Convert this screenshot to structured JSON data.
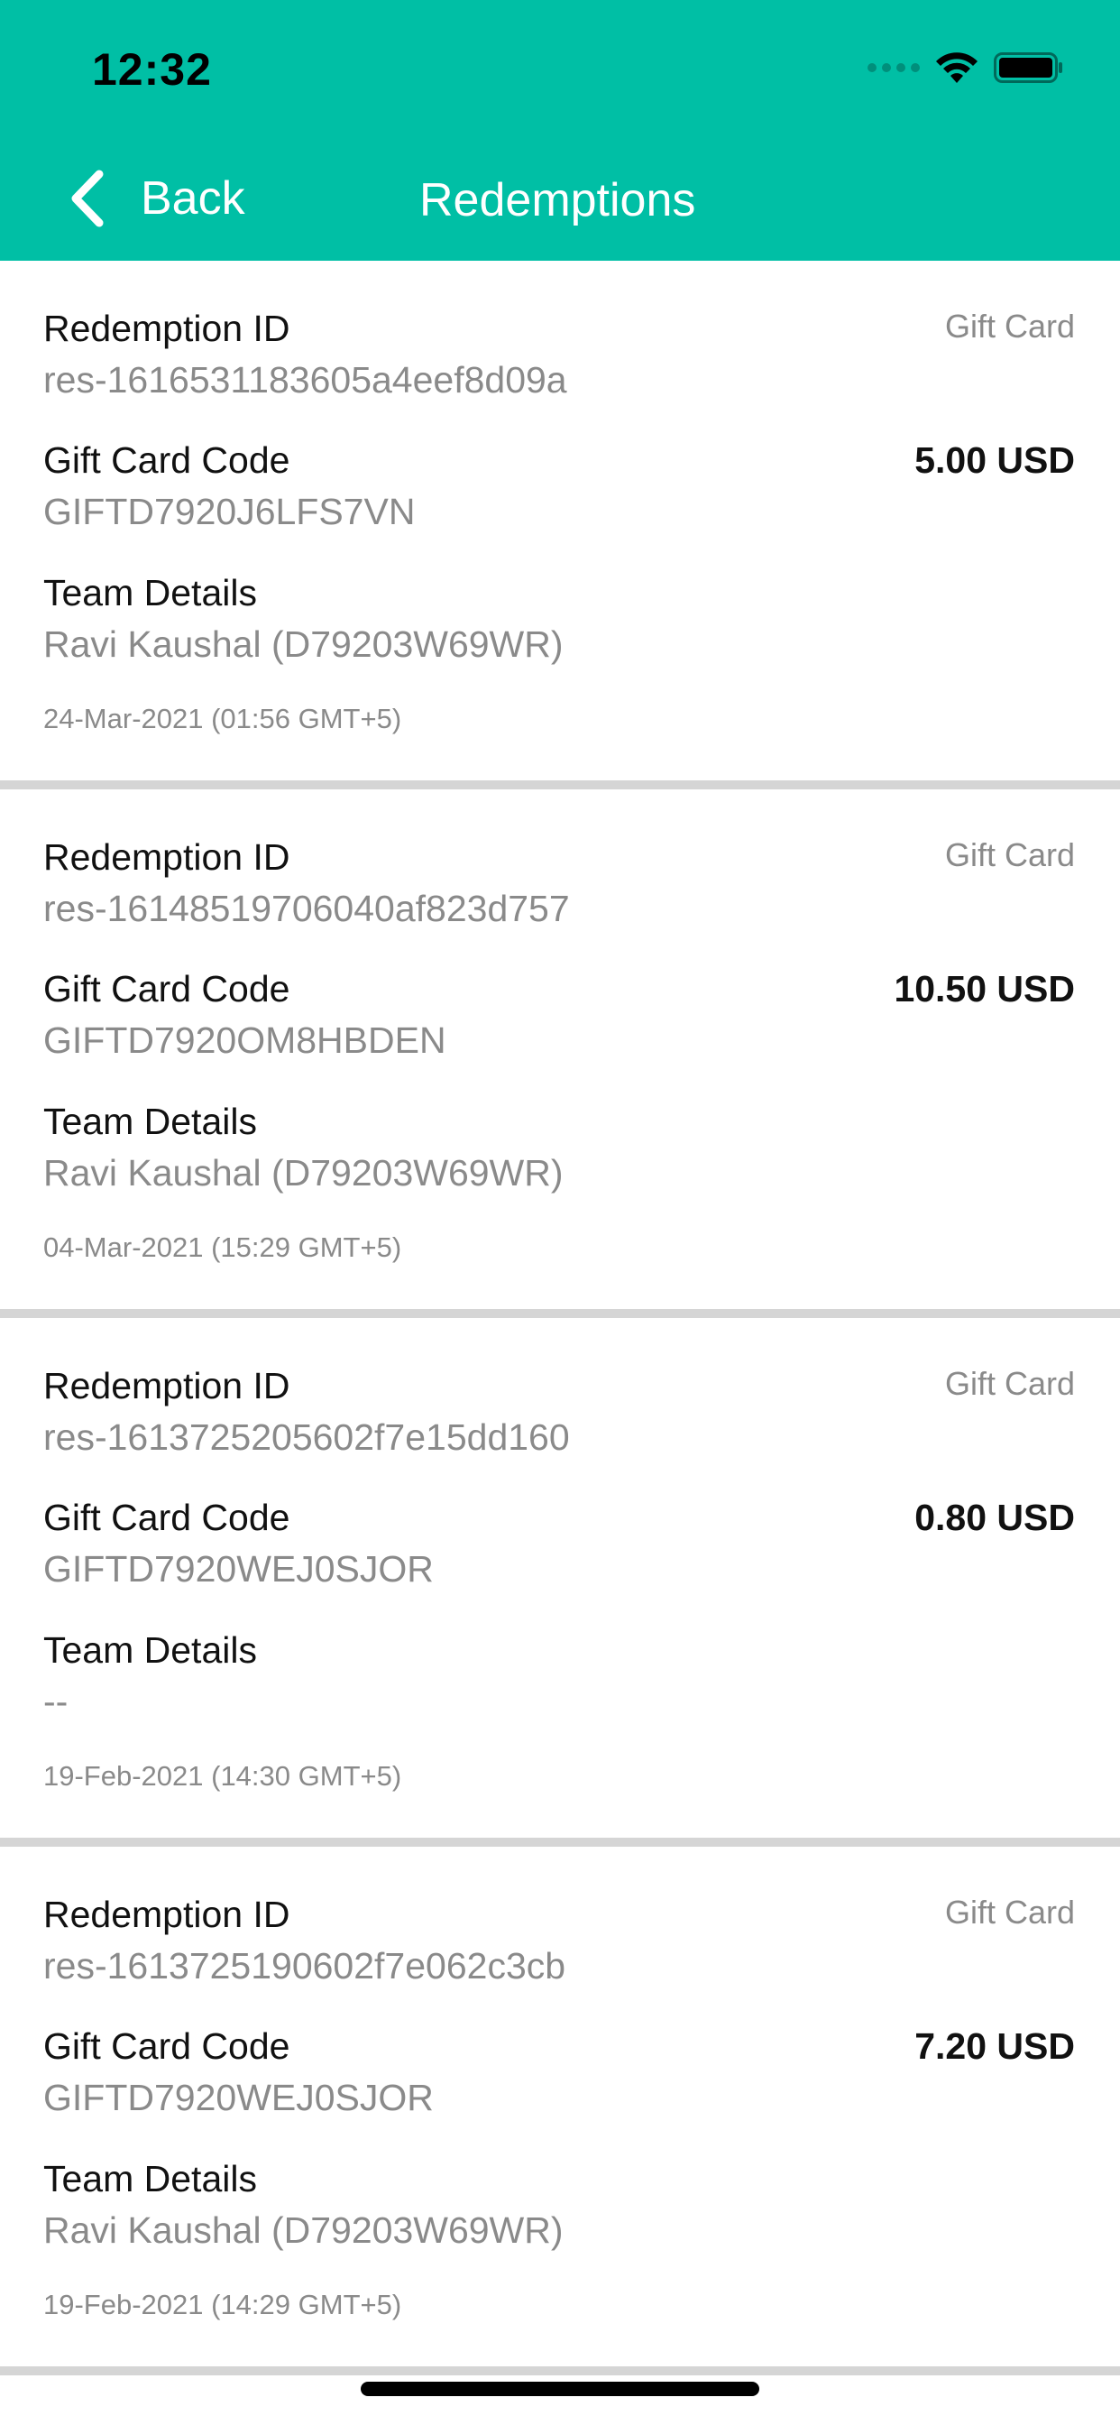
{
  "status_bar": {
    "time": "12:32"
  },
  "nav": {
    "back_label": "Back",
    "title": "Redemptions"
  },
  "labels": {
    "redemption_id": "Redemption ID",
    "gift_card_code": "Gift Card Code",
    "team_details": "Team Details"
  },
  "icons": {
    "back": "chevron-left-icon",
    "signal": "cellular-signal-icon",
    "wifi": "wifi-icon",
    "battery": "battery-icon"
  },
  "colors": {
    "header": "#00BFA5",
    "divider": "#D5D5D5",
    "secondary_text": "#8A8A8A"
  },
  "redemptions": [
    {
      "type": "Gift Card",
      "redemption_id": "res-1616531183605a4eef8d09a",
      "gift_card_code": "GIFTD7920J6LFS7VN",
      "amount": "5.00 USD",
      "team_details": "Ravi Kaushal (D79203W69WR)",
      "date": "24-Mar-2021 (01:56 GMT+5)"
    },
    {
      "type": "Gift Card",
      "redemption_id": "res-16148519706040af823d757",
      "gift_card_code": "GIFTD7920OM8HBDEN",
      "amount": "10.50 USD",
      "team_details": "Ravi Kaushal (D79203W69WR)",
      "date": "04-Mar-2021 (15:29 GMT+5)"
    },
    {
      "type": "Gift Card",
      "redemption_id": "res-1613725205602f7e15dd160",
      "gift_card_code": "GIFTD7920WEJ0SJOR",
      "amount": "0.80 USD",
      "team_details": "--",
      "date": "19-Feb-2021 (14:30 GMT+5)"
    },
    {
      "type": "Gift Card",
      "redemption_id": "res-1613725190602f7e062c3cb",
      "gift_card_code": "GIFTD7920WEJ0SJOR",
      "amount": "7.20 USD",
      "team_details": "Ravi Kaushal (D79203W69WR)",
      "date": "19-Feb-2021 (14:29 GMT+5)"
    }
  ]
}
